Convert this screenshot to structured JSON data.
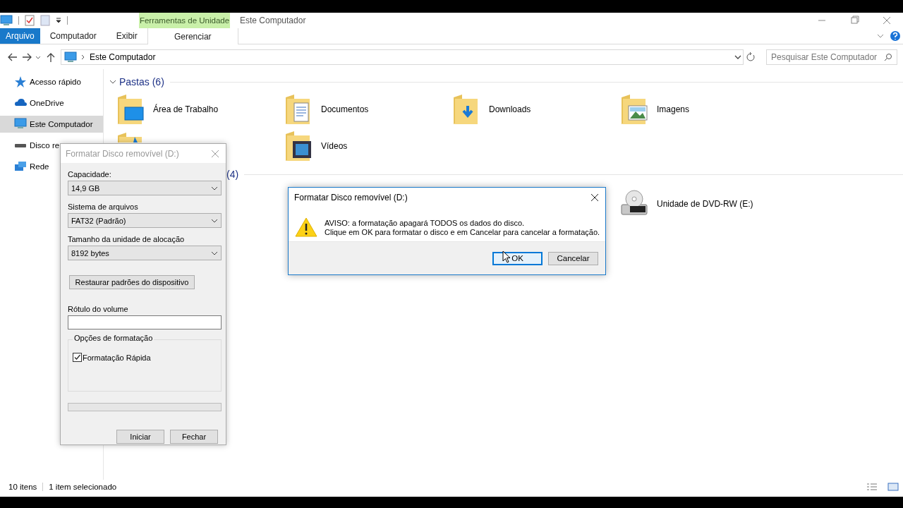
{
  "ribbon": {
    "context_group": "Ferramentas de Unidade",
    "window_title": "Este Computador",
    "tabs": [
      {
        "label": "Arquivo",
        "kind": "file"
      },
      {
        "label": "Computador",
        "kind": "normal"
      },
      {
        "label": "Exibir",
        "kind": "normal"
      },
      {
        "label": "Gerenciar",
        "kind": "contextual"
      }
    ]
  },
  "address_bar": {
    "path": "Este Computador"
  },
  "search": {
    "placeholder": "Pesquisar Este Computador"
  },
  "sidebar": {
    "items": [
      {
        "label": "Acesso rápido",
        "kind": "quick",
        "selected": false
      },
      {
        "label": "OneDrive",
        "kind": "cloud",
        "selected": false
      },
      {
        "label": "Este Computador",
        "kind": "pc",
        "selected": true
      },
      {
        "label": "Disco re",
        "kind": "drive",
        "selected": false
      },
      {
        "label": "Rede",
        "kind": "network",
        "selected": false
      }
    ]
  },
  "sections": [
    {
      "title": "Pastas (6)",
      "kind": "folders",
      "items": [
        {
          "kind": "desktop",
          "label": "Área de Trabalho",
          "selected": false
        },
        {
          "kind": "documents",
          "label": "Documentos",
          "selected": false
        },
        {
          "kind": "downloads",
          "label": "Downloads",
          "selected": false
        },
        {
          "kind": "pictures",
          "label": "Imagens",
          "selected": false
        },
        {
          "kind": "music"
        },
        {
          "kind": "videos",
          "label": "Vídeos",
          "selected": false
        }
      ]
    },
    {
      "title": "(4)",
      "kind": "drives",
      "items": [
        {
          "kind": "dvd",
          "label": "Unidade de DVD-RW (E:)",
          "selected": false
        }
      ]
    }
  ],
  "status_bar": {
    "item_count": "10 itens",
    "selection": "1 item selecionado"
  },
  "format_dialog": {
    "title": "Formatar Disco removível (D:)",
    "active": false,
    "fields": [
      {
        "label": "Capacidade:",
        "value": "14,9 GB"
      },
      {
        "label": "Sistema de arquivos",
        "value": "FAT32 (Padrão)"
      },
      {
        "label": "Tamanho da unidade de alocação",
        "value": "8192 bytes"
      }
    ],
    "restore_button": "Restaurar padrões do dispositivo",
    "volume_label": {
      "label": "Rótulo do volume"
    },
    "options": {
      "title": "Opções de formatação",
      "checkbox": {
        "label": "Formatação Rápida",
        "checked": true
      }
    },
    "progress": {
      "level": 0
    },
    "buttons": [
      "Iniciar",
      "Fechar"
    ]
  },
  "warning_dialog": {
    "title": "Formatar Disco removível (D:)",
    "active": true,
    "message": [
      "AVISO: a formatação apagará TODOS os dados do disco.",
      "Clique em OK para formatar o disco e em Cancelar para cancelar a formatação."
    ],
    "buttons": [
      {
        "label": "OK",
        "default": true
      },
      {
        "label": "Cancelar",
        "default": false
      }
    ]
  }
}
